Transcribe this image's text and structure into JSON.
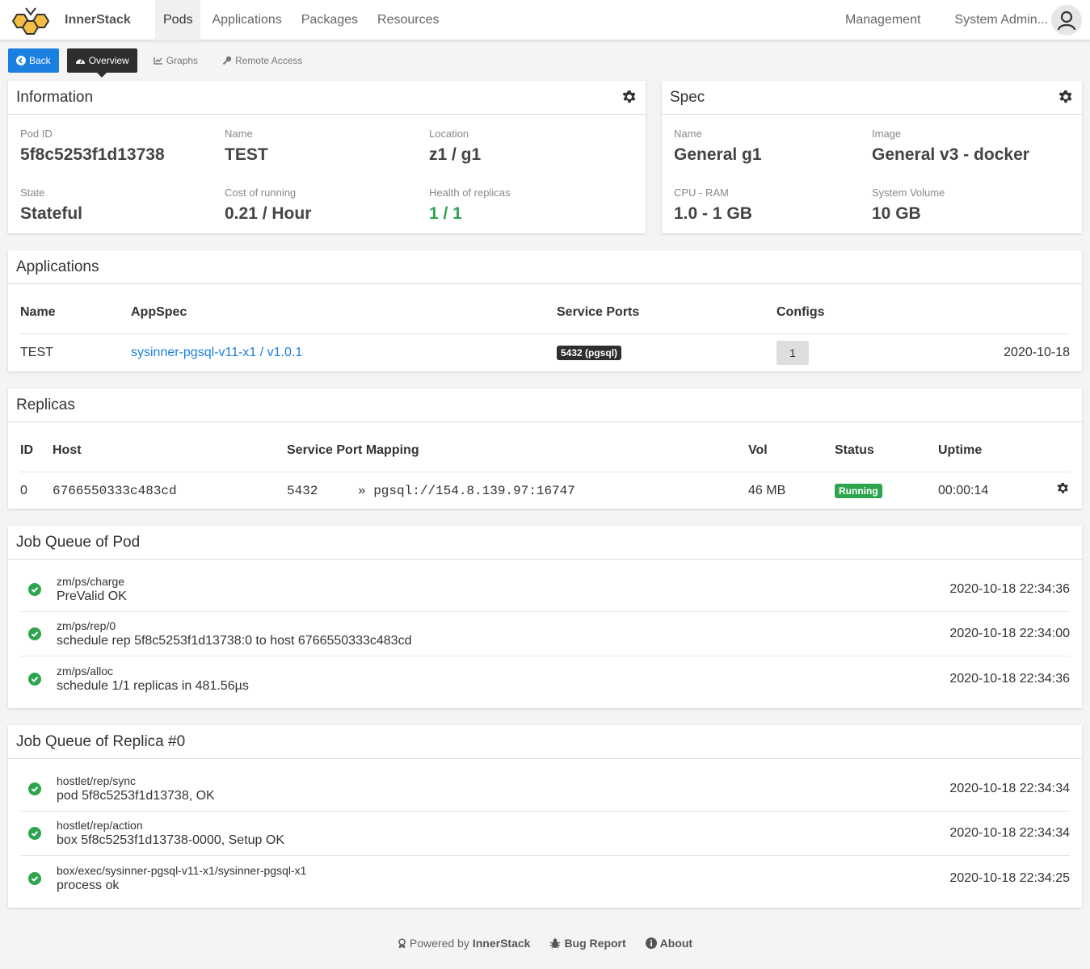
{
  "header": {
    "brand": "InnerStack",
    "nav": [
      {
        "label": "Pods",
        "active": true
      },
      {
        "label": "Applications",
        "active": false
      },
      {
        "label": "Packages",
        "active": false
      },
      {
        "label": "Resources",
        "active": false
      }
    ],
    "management": "Management",
    "user": "System Admin..."
  },
  "subnav": {
    "back": "Back",
    "overview": "Overview",
    "graphs": "Graphs",
    "remote_access": "Remote Access"
  },
  "information": {
    "title": "Information",
    "fields": [
      {
        "label": "Pod ID",
        "value": "5f8c5253f1d13738"
      },
      {
        "label": "Name",
        "value": "TEST"
      },
      {
        "label": "Location",
        "value": "z1 / g1"
      },
      {
        "label": "State",
        "value": "Stateful"
      },
      {
        "label": "Cost of running",
        "value": "0.21 / Hour"
      },
      {
        "label": "Health of replicas",
        "value": "1 / 1"
      }
    ]
  },
  "spec": {
    "title": "Spec",
    "fields": [
      {
        "label": "Name",
        "value": "General g1"
      },
      {
        "label": "Image",
        "value": "General v3 - docker"
      },
      {
        "label": "CPU - RAM",
        "value": "1.0 - 1 GB"
      },
      {
        "label": "System Volume",
        "value": "10 GB"
      }
    ]
  },
  "applications": {
    "title": "Applications",
    "headers": [
      "Name",
      "AppSpec",
      "Service Ports",
      "Configs"
    ],
    "rows": [
      {
        "name": "TEST",
        "appspec": "sysinner-pgsql-v11-x1 / v1.0.1",
        "port": "5432 (pgsql)",
        "configs": "1",
        "date": "2020-10-18"
      }
    ]
  },
  "replicas": {
    "title": "Replicas",
    "headers": [
      "ID",
      "Host",
      "Service Port Mapping",
      "Vol",
      "Status",
      "Uptime"
    ],
    "rows": [
      {
        "id": "0",
        "host": "6766550333c483cd",
        "port": "5432",
        "mapping": "» pgsql://154.8.139.97:16747",
        "vol": "46 MB",
        "status": "Running",
        "uptime": "00:00:14"
      }
    ]
  },
  "pod_jobs": {
    "title": "Job Queue of Pod",
    "items": [
      {
        "name": "zm/ps/charge",
        "msg": "PreValid OK",
        "time": "2020-10-18 22:34:36"
      },
      {
        "name": "zm/ps/rep/0",
        "msg": "schedule rep 5f8c5253f1d13738:0 to host 6766550333c483cd",
        "time": "2020-10-18 22:34:00"
      },
      {
        "name": "zm/ps/alloc",
        "msg": "schedule 1/1 replicas in 481.56µs",
        "time": "2020-10-18 22:34:36"
      }
    ]
  },
  "replica_jobs": {
    "title": "Job Queue of Replica #0",
    "items": [
      {
        "name": "hostlet/rep/sync",
        "msg": "pod 5f8c5253f1d13738, OK",
        "time": "2020-10-18 22:34:34"
      },
      {
        "name": "hostlet/rep/action",
        "msg": "box 5f8c5253f1d13738-0000, Setup OK",
        "time": "2020-10-18 22:34:34"
      },
      {
        "name": "box/exec/sysinner-pgsql-v11-x1/sysinner-pgsql-x1",
        "msg": "process ok",
        "time": "2020-10-18 22:34:25"
      }
    ]
  },
  "footer": {
    "powered_prefix": "Powered by",
    "powered_brand": "InnerStack",
    "bug_report": "Bug Report",
    "about": "About"
  },
  "colors": {
    "accent": "#1a7fe0",
    "success": "#2ea44f",
    "dark": "#2e2e2e"
  }
}
